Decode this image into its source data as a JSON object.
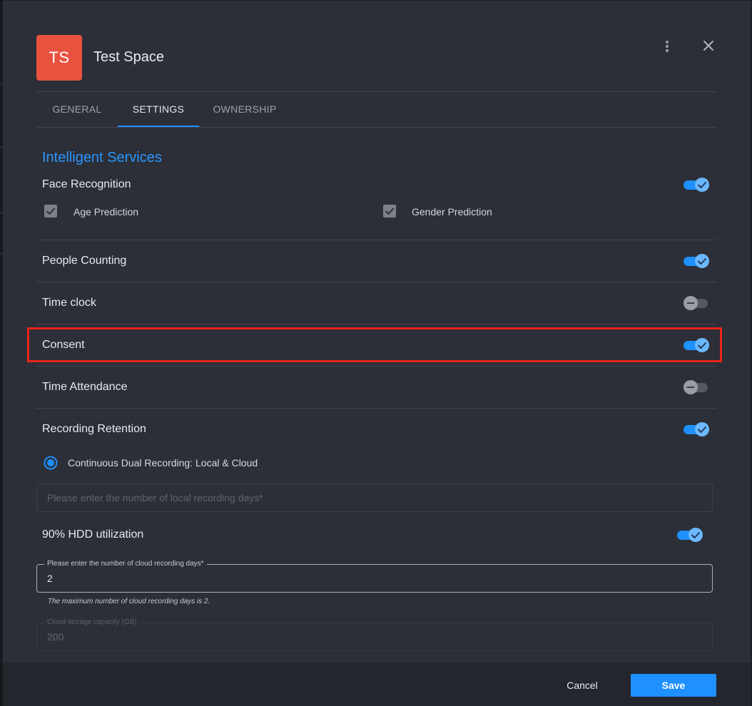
{
  "header": {
    "avatar_initials": "TS",
    "title": "Test Space",
    "avatar_color": "#e8533f"
  },
  "tabs": [
    {
      "label": "GENERAL",
      "active": false
    },
    {
      "label": "SETTINGS",
      "active": true
    },
    {
      "label": "OWNERSHIP",
      "active": false
    }
  ],
  "intelligent_services": {
    "title": "Intelligent Services",
    "face_recognition": {
      "label": "Face Recognition",
      "enabled": true,
      "options": [
        {
          "label": "Age Prediction",
          "checked": true
        },
        {
          "label": "Gender Prediction",
          "checked": true
        }
      ]
    },
    "people_counting": {
      "label": "People Counting",
      "enabled": true
    },
    "time_clock": {
      "label": "Time clock",
      "enabled": false
    },
    "consent": {
      "label": "Consent",
      "enabled": true
    },
    "time_attendance": {
      "label": "Time Attendance",
      "enabled": false
    }
  },
  "recording_retention": {
    "label": "Recording Retention",
    "enabled": true,
    "mode_option": "Continuous Dual Recording: Local & Cloud",
    "local_days_placeholder": "Please enter the number of local recording days*",
    "hdd_utilization": {
      "label": "90% HDD utilization",
      "enabled": true
    },
    "cloud_days_label": "Please enter the number of cloud recording days*",
    "cloud_days_value": "2",
    "cloud_days_helper": "The maximum number of cloud recording days is 2.",
    "cloud_capacity_label": "Cloud storage capacity (GB)",
    "cloud_capacity_value": "200"
  },
  "footer": {
    "cancel_label": "Cancel",
    "save_label": "Save"
  },
  "colors": {
    "accent": "#1e90ff",
    "highlight": "#e8261b",
    "background": "#2c2f37"
  }
}
